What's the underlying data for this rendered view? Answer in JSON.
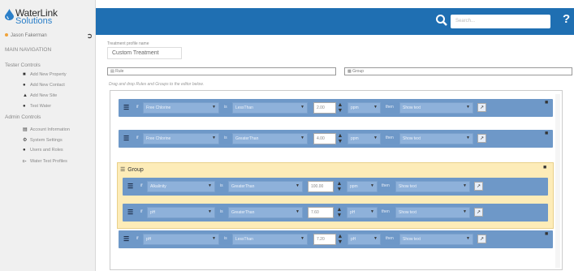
{
  "logo": {
    "line1": "WaterLink",
    "line2": "Solutions"
  },
  "user": {
    "name": "Jason Fakerman"
  },
  "nav": {
    "main_header": "MAIN NAVIGATION",
    "tester_header": "Tester Controls",
    "tester_items": [
      {
        "label": "Add New Property",
        "icon": "building-icon"
      },
      {
        "label": "Add New Contact",
        "icon": "user-icon"
      },
      {
        "label": "Add New Site",
        "icon": "site-icon"
      },
      {
        "label": "Test Water",
        "icon": "drop-icon"
      }
    ],
    "admin_header": "Admin Controls",
    "admin_items": [
      {
        "label": "Account Information",
        "icon": "card-icon"
      },
      {
        "label": "System Settings",
        "icon": "gear-icon"
      },
      {
        "label": "Users and Roles",
        "icon": "users-icon"
      },
      {
        "label": "Water Test Profiles",
        "icon": "flask-icon"
      }
    ]
  },
  "topbar": {
    "search_placeholder": "Search...",
    "help": "?",
    "color": "#1f6fb2"
  },
  "form": {
    "profile_label": "Treatment profile name",
    "profile_value": "Custom Treatment",
    "add_rule": "Rule",
    "add_group": "Group",
    "hint": "Drag and drop Rules and Groups to the editor below."
  },
  "rule_words": {
    "if": "if",
    "is": "is",
    "then": "then"
  },
  "rules": [
    {
      "param": "Free Chlorine",
      "op": "LessThan",
      "value": "2.00",
      "unit": "ppm",
      "action": "Show text"
    },
    {
      "param": "Free Chlorine",
      "op": "GreaterThan",
      "value": "4.00",
      "unit": "ppm",
      "action": "Show text"
    }
  ],
  "group": {
    "title": "Group",
    "rules": [
      {
        "param": "Alkalinity",
        "op": "GreaterThan",
        "value": "100.00",
        "unit": "ppm",
        "action": "Show text"
      },
      {
        "param": "pH",
        "op": "GreaterThan",
        "value": "7.60",
        "unit": "pH",
        "action": "Show text"
      }
    ]
  },
  "rules_after": [
    {
      "param": "pH",
      "op": "LessThan",
      "value": "7.20",
      "unit": "pH",
      "action": "Show text"
    }
  ],
  "colors": {
    "rule_bg": "#6e98c8",
    "group_bg": "#fdecb8",
    "accent": "#1f6fb2"
  }
}
